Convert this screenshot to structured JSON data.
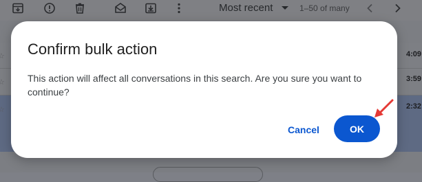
{
  "toolbar": {
    "sort_label": "Most recent",
    "page_count": "1–50 of many",
    "icons": [
      "archive-icon",
      "report-spam-icon",
      "delete-icon",
      "mark-unread-icon",
      "move-to-icon",
      "more-vert-icon",
      "chevron-left-icon",
      "chevron-right-icon"
    ]
  },
  "background_rows": [
    {
      "time": "4:09"
    },
    {
      "time": "3:59"
    },
    {
      "time": "2:32"
    }
  ],
  "dialog": {
    "title": "Confirm bulk action",
    "message": "This action will affect all conversations in this search. Are you sure you want to continue?",
    "cancel_label": "Cancel",
    "ok_label": "OK"
  },
  "colors": {
    "accent": "#0b57d0",
    "annotation_arrow": "#e53935",
    "overlay": "#7e8087"
  }
}
